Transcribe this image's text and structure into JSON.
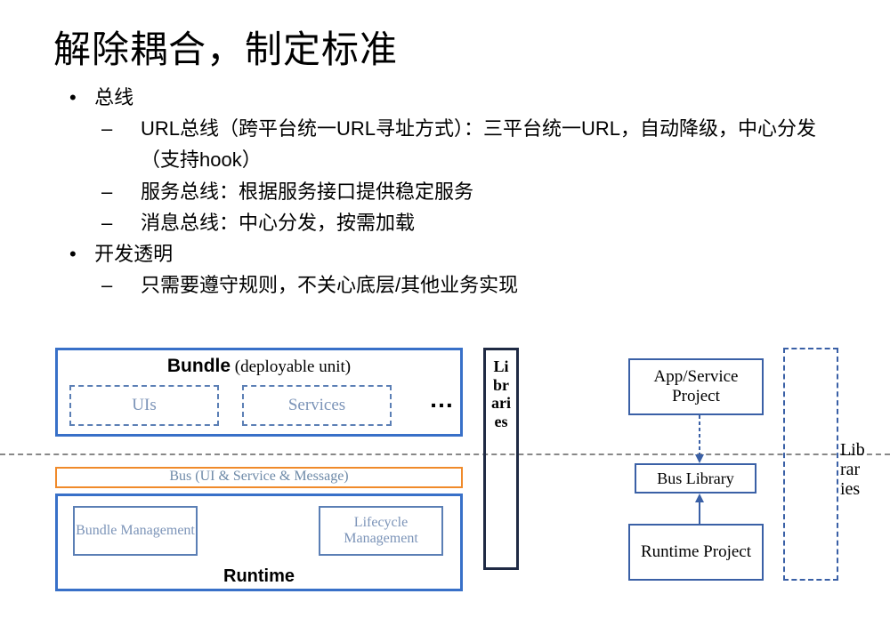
{
  "title": "解除耦合，制定标准",
  "bullets": {
    "bus": "总线",
    "bus_items": [
      "URL总线（跨平台统一URL寻址方式）：三平台统一URL，自动降级，中心分发（支持hook）",
      "服务总线：根据服务接口提供稳定服务",
      "消息总线：中心分发，按需加载"
    ],
    "dev": "开发透明",
    "dev_items": [
      "只需要遵守规则，不关心底层/其他业务实现"
    ]
  },
  "diagram": {
    "bundle_title_bold": "Bundle",
    "bundle_title_sub": " (deployable unit)",
    "uis": "UIs",
    "services": "Services",
    "ellipsis": "…",
    "libraries_left": "Libraries",
    "bus_bar": "Bus (UI & Service & Message)",
    "bundle_mgmt": "Bundle Management",
    "lifecycle_mgmt": "Lifecycle Management",
    "runtime": "Runtime",
    "app_project": "App/Service Project",
    "bus_library": "Bus Library",
    "runtime_project": "Runtime Project",
    "libraries_right": "Libraries"
  }
}
